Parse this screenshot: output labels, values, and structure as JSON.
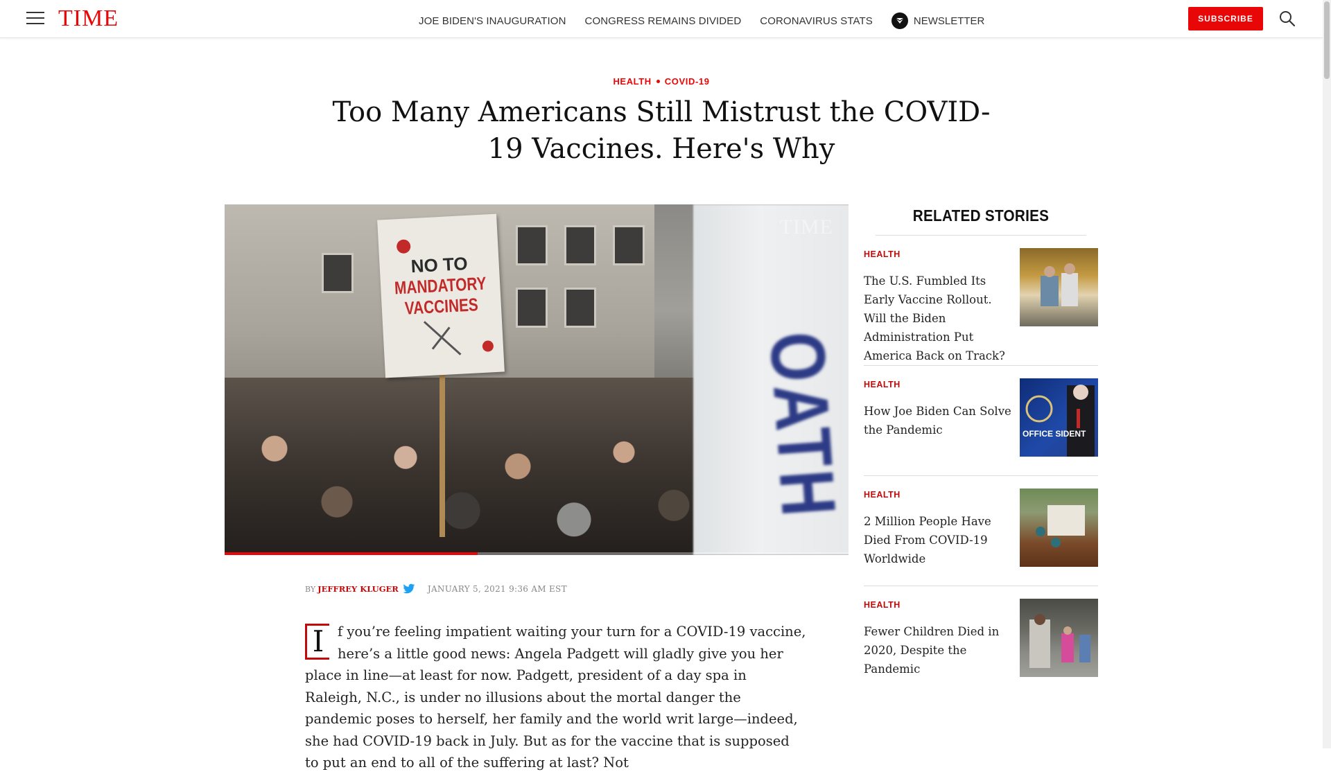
{
  "nav": {
    "logo": "TIME",
    "links": [
      "JOE BIDEN'S INAUGURATION",
      "CONGRESS REMAINS DIVIDED",
      "CORONAVIRUS STATS"
    ],
    "newsletter_label": "NEWSLETTER",
    "subscribe_label": "SUBSCRIBE"
  },
  "article": {
    "kicker": [
      "HEALTH",
      "COVID-19"
    ],
    "headline": "Too Many Americans Still Mistrust the COVID-19 Vaccines. Here's Why",
    "video": {
      "sign_line1": "NO TO",
      "sign_line2": "MANDATORY",
      "sign_line3": "VACCINES",
      "background_sign": "OATH",
      "watermark": "TIME",
      "progress_fraction": 0.405
    },
    "byline": {
      "by": "BY",
      "author": "JEFFREY KLUGER",
      "date": "JANUARY 5, 2021 9:36 AM EST"
    },
    "dropcap": "I",
    "body": "f you’re feeling impatient waiting your turn for a COVID-19 vaccine, here’s a little good news: Angela Padgett will gladly give you her place in line—at least for now. Padgett, president of a day spa in Raleigh, N.C., is under no illusions about the mortal danger the pandemic poses to herself, her family and the world writ large—indeed, she had COVID-19 back in July. But as for the vaccine that is supposed to put an end to all of the suffering at last? Not"
  },
  "related": {
    "title": "RELATED STORIES",
    "items": [
      {
        "tag": "HEALTH",
        "headline": "The U.S. Fumbled Its Early Vaccine Rollout. Will the Biden Administration Put America Back on Track?"
      },
      {
        "tag": "HEALTH",
        "headline": "How Joe Biden Can Solve the Pandemic",
        "image_text": "OFFICE SIDENT"
      },
      {
        "tag": "HEALTH",
        "headline": "2 Million People Have Died From COVID-19 Worldwide"
      },
      {
        "tag": "HEALTH",
        "headline": "Fewer Children Died in 2020, Despite the Pandemic"
      }
    ]
  },
  "colors": {
    "brand_red": "#e90606",
    "tag_red": "#c20a0a",
    "twitter_blue": "#1da1f2"
  }
}
